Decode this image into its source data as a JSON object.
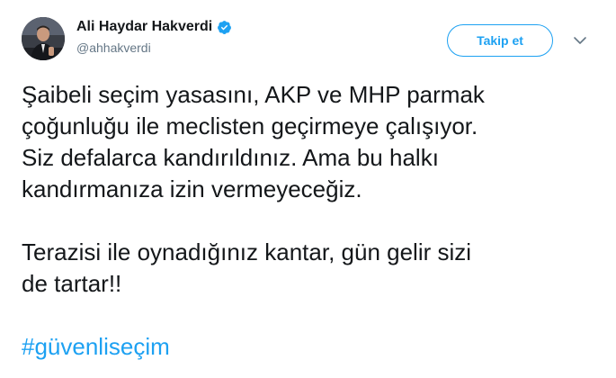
{
  "author": {
    "display_name": "Ali Haydar Hakverdi",
    "handle": "@ahhakverdi",
    "verified": true,
    "avatar_icon": "profile-photo"
  },
  "actions": {
    "follow_label": "Takip et",
    "menu_icon": "chevron-down-icon"
  },
  "tweet": {
    "paragraph_1": "Şaibeli seçim yasasını, AKP ve MHP parmak\nçoğunluğu ile meclisten geçirmeye çalışıyor.\nSiz defalarca kandırıldınız. Ama bu halkı\nkandırmanıza izin vermeyeceğiz.",
    "paragraph_2": "Terazisi ile oynadığınız kantar, gün gelir sizi\nde tartar!!",
    "hashtag": "#güvenliseçim"
  },
  "colors": {
    "accent": "#1da1f2",
    "text": "#14171a",
    "secondary_text": "#657786"
  }
}
